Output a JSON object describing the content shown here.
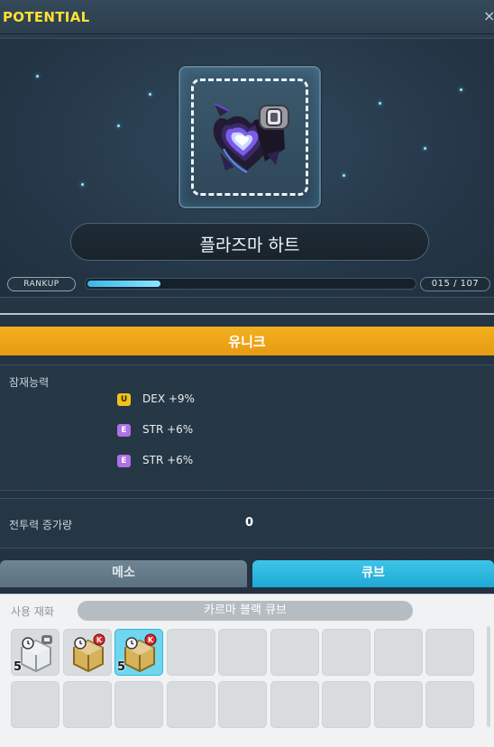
{
  "window": {
    "title": "POTENTIAL",
    "close_glyph": "×"
  },
  "item": {
    "name": "플라즈마 하트",
    "icon": "plasma-heart-icon",
    "rank": {
      "badge": "RANKUP",
      "current": 15,
      "max": 107,
      "label": "015 / 107"
    }
  },
  "grade": {
    "label": "유니크",
    "color": "#f0a81a"
  },
  "potential": {
    "label": "잠재능력",
    "lines": [
      {
        "grade_letter": "U",
        "grade_color": "#f2c21b",
        "text": "DEX +9%"
      },
      {
        "grade_letter": "E",
        "grade_color": "#b071e6",
        "text": "STR +6%"
      },
      {
        "grade_letter": "E",
        "grade_color": "#b071e6",
        "text": "STR +6%"
      }
    ]
  },
  "combat_power": {
    "label": "전투력 증가량",
    "value": "0"
  },
  "tabs": [
    {
      "label": "메소",
      "active": false
    },
    {
      "label": "큐브",
      "active": true
    }
  ],
  "materials": {
    "label": "사용 재화",
    "selected_cube": "카르마 블랙 큐브",
    "slots": [
      {
        "icon": "white-cube-icon",
        "count": "5",
        "selected": false
      },
      {
        "icon": "karma-red-cube-icon",
        "count": "",
        "selected": false
      },
      {
        "icon": "karma-black-cube-icon",
        "count": "5",
        "selected": true
      },
      {
        "icon": "",
        "count": "",
        "selected": false
      },
      {
        "icon": "",
        "count": "",
        "selected": false
      },
      {
        "icon": "",
        "count": "",
        "selected": false
      },
      {
        "icon": "",
        "count": "",
        "selected": false
      },
      {
        "icon": "",
        "count": "",
        "selected": false
      },
      {
        "icon": "",
        "count": "",
        "selected": false
      },
      {
        "icon": "",
        "count": "",
        "selected": false
      },
      {
        "icon": "",
        "count": "",
        "selected": false
      },
      {
        "icon": "",
        "count": "",
        "selected": false
      },
      {
        "icon": "",
        "count": "",
        "selected": false
      },
      {
        "icon": "",
        "count": "",
        "selected": false
      },
      {
        "icon": "",
        "count": "",
        "selected": false
      },
      {
        "icon": "",
        "count": "",
        "selected": false
      },
      {
        "icon": "",
        "count": "",
        "selected": false
      },
      {
        "icon": "",
        "count": "",
        "selected": false
      }
    ]
  }
}
